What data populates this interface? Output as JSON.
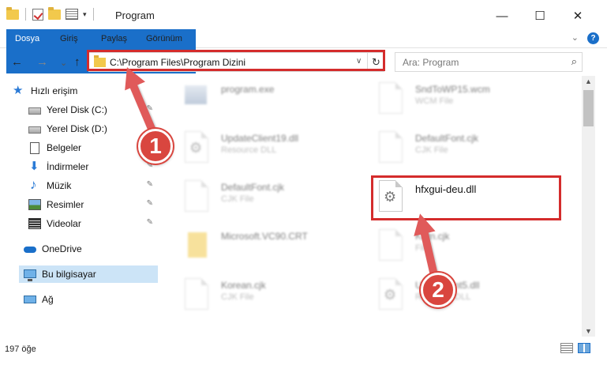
{
  "window": {
    "title": "Program",
    "minimize": "—",
    "maximize": "☐",
    "close": "✕"
  },
  "ribbon": {
    "tabs": [
      "Dosya",
      "Giriş",
      "Paylaş",
      "Görünüm"
    ],
    "expand": "⌄",
    "help": "?"
  },
  "nav": {
    "back": "←",
    "forward": "→",
    "recent": "⌄",
    "up": "↑",
    "address": "C:\\Program Files\\Program Dizini",
    "refresh": "↻",
    "search_placeholder": "Ara: Program",
    "search_icon": "⌕"
  },
  "sidebar": {
    "items": [
      {
        "label": "Hızlı erişim",
        "icon": "star-icon"
      },
      {
        "label": "Yerel Disk (C:)",
        "icon": "disk-icon"
      },
      {
        "label": "Yerel Disk (D:)",
        "icon": "disk-icon"
      },
      {
        "label": "Belgeler",
        "icon": "document-icon"
      },
      {
        "label": "İndirmeler",
        "icon": "download-icon"
      },
      {
        "label": "Müzik",
        "icon": "music-icon"
      },
      {
        "label": "Resimler",
        "icon": "pictures-icon"
      },
      {
        "label": "Videolar",
        "icon": "video-icon"
      },
      {
        "label": "OneDrive",
        "icon": "cloud-icon"
      },
      {
        "label": "Bu bilgisayar",
        "icon": "computer-icon"
      },
      {
        "label": "Ağ",
        "icon": "network-icon"
      }
    ],
    "pin": "📌"
  },
  "files": [
    {
      "name": "program.exe",
      "type": ""
    },
    {
      "name": "SndToWP15.wcm",
      "type": "WCM File"
    },
    {
      "name": "UpdateClient19.dll",
      "type": "Resource DLL"
    },
    {
      "name": "DefaultFont.cjk",
      "type": "CJK File"
    },
    {
      "name": "DefaultFont.cjk",
      "type": "CJK File"
    },
    {
      "name": "hfxgui-deu.dll",
      "type": ""
    },
    {
      "name": "Microsoft.VC90.CRT",
      "type": ""
    },
    {
      "name": "Korn.cjk",
      "type": "File"
    },
    {
      "name": "Korean.cjk",
      "type": "CJK File"
    },
    {
      "name": "U___Client5.dll",
      "type": "Resource DLL"
    }
  ],
  "status": {
    "count": "197 öğe"
  },
  "annotations": {
    "step1": "1",
    "step2": "2",
    "accent": "#d42c2c"
  },
  "colors": {
    "file_tab": "#1a6fc9",
    "selected_nav": "#cce4f7"
  }
}
